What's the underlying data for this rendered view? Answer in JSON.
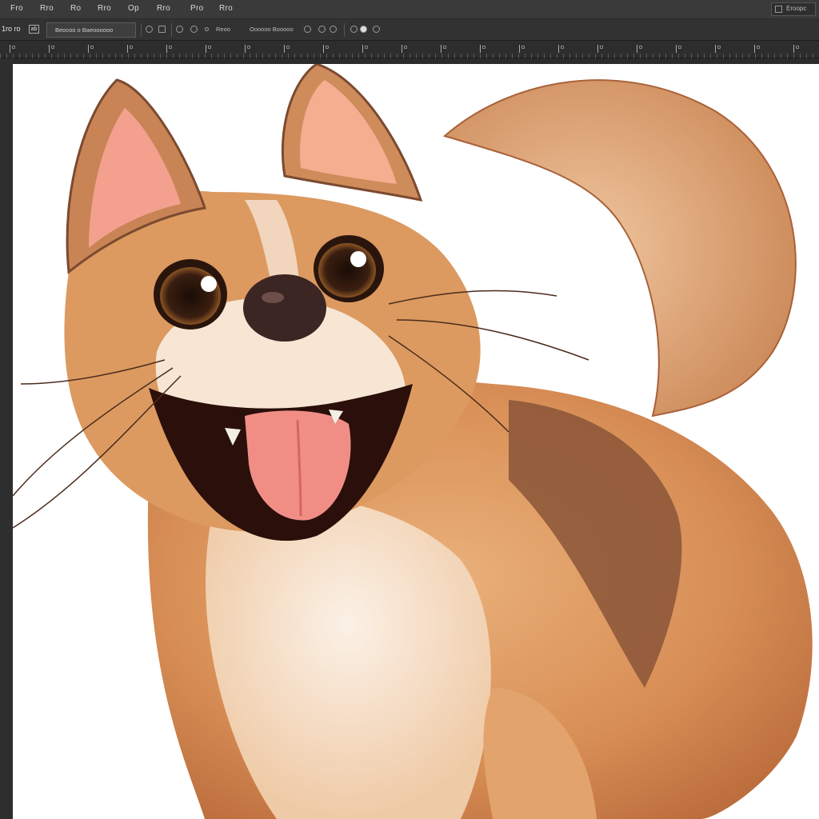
{
  "menu": {
    "items": [
      "Fro",
      "Rro",
      "Ro",
      "Rro",
      "Op",
      "Rro",
      "Pro",
      "Rro"
    ]
  },
  "search": {
    "label": "Eroopc"
  },
  "options": {
    "tool_label": "1ro ro",
    "tool_box": "ab",
    "preset_label": "Beocoo o Baeoooooo",
    "option_1": "Reoo",
    "option_2": "Oooooo Booooo"
  },
  "canvas": {
    "artwork": "cartoon-dog",
    "colors": {
      "fur": "#d9965f",
      "fur_dark": "#7a4a34",
      "cream": "#f6e7d8",
      "nose": "#3b2624",
      "tongue": "#f08e86"
    }
  }
}
